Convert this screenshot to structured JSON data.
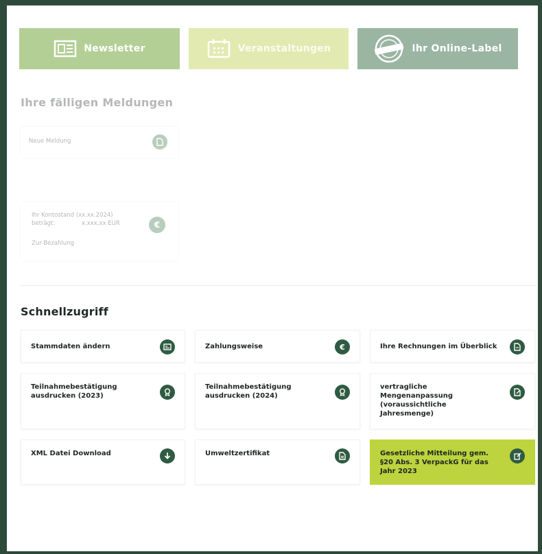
{
  "top_buttons": {
    "newsletter": "Newsletter",
    "events": "Veranstaltungen",
    "online_label": "Ihr Online-Label"
  },
  "due_reports": {
    "title": "Ihre fälligen Meldungen",
    "new_report": "Neue Meldung",
    "account_line1": "Ihr Kontostand (xx.xx.2024)",
    "account_line2_label": "beträgt:",
    "account_line2_value": "x.xxx,xx EUR",
    "pay_link": "Zur Bezahlung"
  },
  "quick_access": {
    "title": "Schnellzugriff",
    "tiles": [
      {
        "label": "Stammdaten ändern",
        "icon": "id-card-icon"
      },
      {
        "label": "Zahlungsweise",
        "icon": "euro-icon"
      },
      {
        "label": "Ihre Rechnungen im Überblick",
        "icon": "document-icon"
      },
      {
        "label": "Teilnahmebestätigung ausdrucken (2023)",
        "icon": "award-icon"
      },
      {
        "label": "Teilnahmebestätigung ausdrucken (2024)",
        "icon": "award-icon"
      },
      {
        "label": "vertragliche Mengenanpassung (voraussichtliche Jahresmenge)",
        "icon": "edit-document-icon"
      },
      {
        "label": "XML Datei Download",
        "icon": "download-icon"
      },
      {
        "label": "Umweltzertifikat",
        "icon": "certificate-icon"
      },
      {
        "label": "Gesetzliche Mitteilung gem. §20 Abs. 3 VerpackG für das Jahr 2023",
        "icon": "edit-icon"
      }
    ]
  },
  "colors": {
    "frame": "#2e4a3a",
    "icon_bg": "#2f5b42",
    "highlight": "#bdd43e",
    "newsletter_bg": "#b3cf96",
    "events_bg": "#e2eab1",
    "label_bg": "#9bb5a3"
  }
}
